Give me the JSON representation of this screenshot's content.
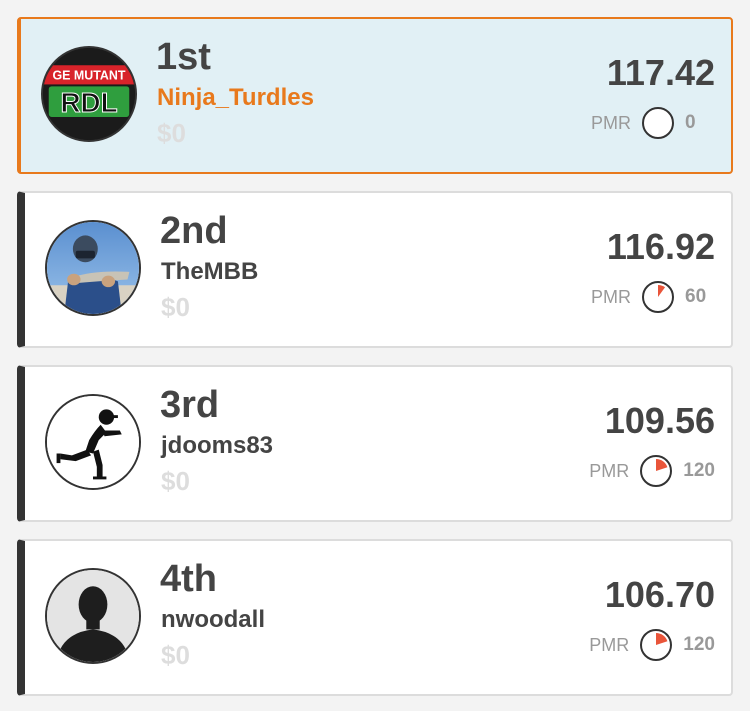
{
  "colors": {
    "accent": "#e8791c",
    "highlight_background": "#e1f0f5",
    "pmr_fill": "#e9553a",
    "text_dark": "#444444",
    "text_muted": "#999999",
    "money_muted": "#dddddd"
  },
  "standings": [
    {
      "rank": "1st",
      "username": "Ninja_Turdles",
      "money": "$0",
      "score": "117.42",
      "pmr_label": "PMR",
      "pmr_value": "0",
      "pmr_fraction": 0,
      "avatar_icon": "turtles-logo-avatar",
      "avatar_logo_top": "GE MUTANT",
      "avatar_logo_main": "RDL",
      "highlighted": true
    },
    {
      "rank": "2nd",
      "username": "TheMBB",
      "money": "$0",
      "score": "116.92",
      "pmr_label": "PMR",
      "pmr_value": "60",
      "pmr_fraction": 0.1,
      "avatar_icon": "photo-avatar",
      "highlighted": false
    },
    {
      "rank": "3rd",
      "username": "jdooms83",
      "money": "$0",
      "score": "109.56",
      "pmr_label": "PMR",
      "pmr_value": "120",
      "pmr_fraction": 0.2,
      "avatar_icon": "football-runner-avatar",
      "highlighted": false
    },
    {
      "rank": "4th",
      "username": "nwoodall",
      "money": "$0",
      "score": "106.70",
      "pmr_label": "PMR",
      "pmr_value": "120",
      "pmr_fraction": 0.2,
      "avatar_icon": "default-person-avatar",
      "highlighted": false
    }
  ]
}
